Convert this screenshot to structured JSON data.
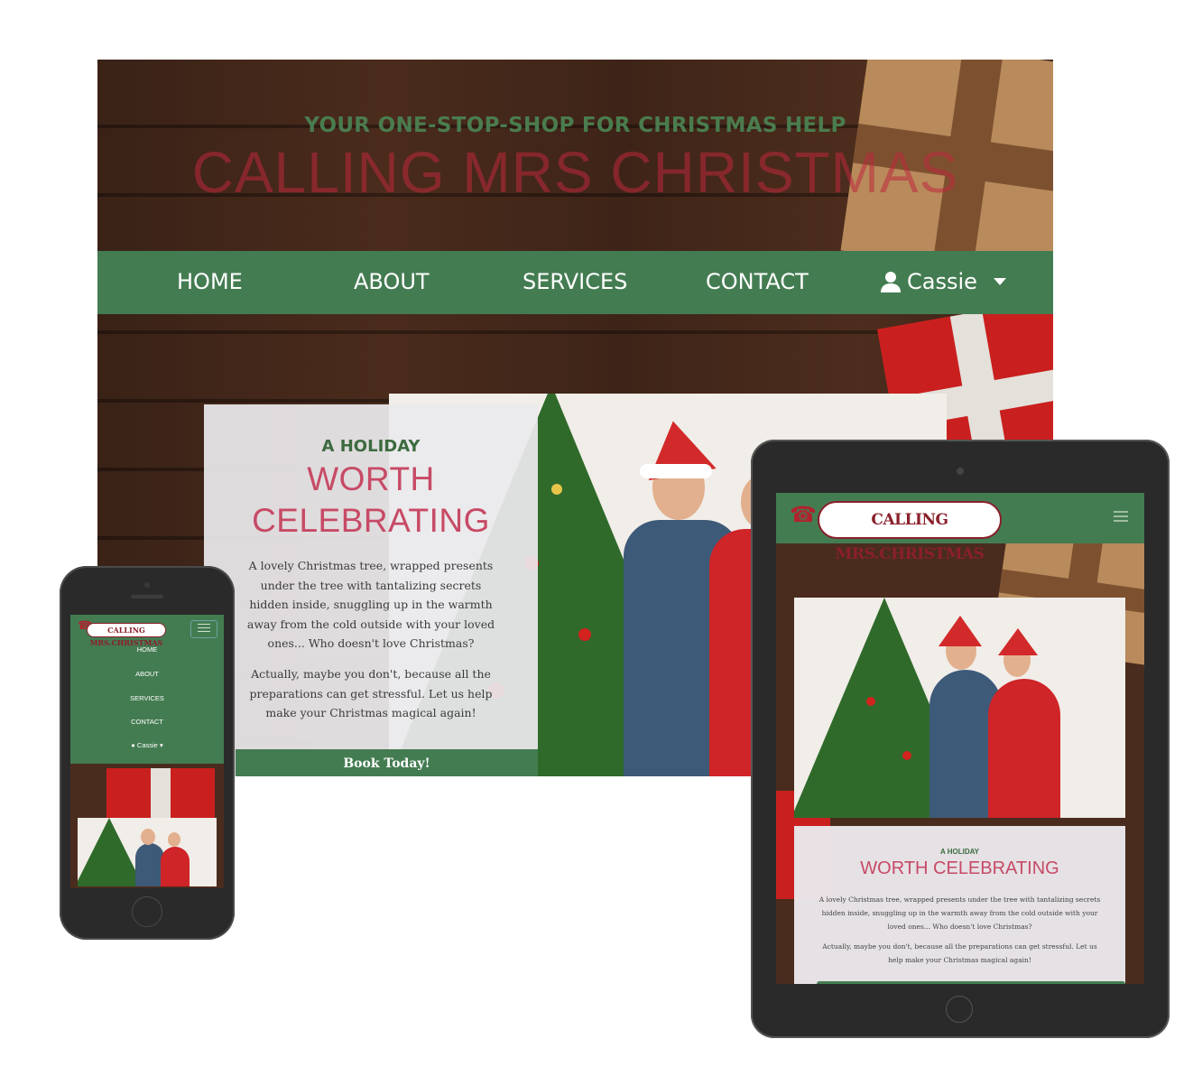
{
  "desktop": {
    "tagline": "YOUR ONE-STOP-SHOP FOR CHRISTMAS HELP",
    "site_title": "CALLING MRS CHRISTMAS",
    "nav": {
      "home": "HOME",
      "about": "ABOUT",
      "services": "SERVICES",
      "contact": "CONTACT",
      "user": "Cassie"
    },
    "card": {
      "eyebrow": "A HOLIDAY",
      "heading_line1": "WORTH",
      "heading_line2": "CELEBRATING",
      "paragraph1": "A lovely Christmas tree, wrapped presents under the tree with tantalizing secrets hidden inside, snuggling up in the warmth away from the cold outside with your loved ones... Who doesn't love Christmas?",
      "paragraph2": "Actually, maybe you don't, because all the preparations can get stressful. Let us help make your Christmas magical again!",
      "cta": "Book Today!"
    }
  },
  "tablet": {
    "logo_text": "CALLING MRS.CHRISTMAS",
    "card": {
      "eyebrow": "A HOLIDAY",
      "heading": "WORTH CELEBRATING",
      "paragraph1": "A lovely Christmas tree, wrapped presents under the tree with tantalizing secrets hidden inside, snuggling up in the warmth away from the cold outside with your loved ones... Who doesn't love Christmas?",
      "paragraph2": "Actually, maybe you don't, because all the preparations can get stressful. Let us help make your Christmas magical again!"
    }
  },
  "phone": {
    "logo_text": "CALLING MRS.CHRISTMAS",
    "menu": {
      "home": "HOME",
      "about": "ABOUT",
      "services": "SERVICES",
      "contact": "CONTACT",
      "user": "Cassie"
    }
  },
  "colors": {
    "brand_green": "#447c52",
    "tagline_green": "#4a7c4e",
    "heading_rose": "#c74a66",
    "logo_red": "#8a1f2a",
    "wood_brown": "#3e2418"
  },
  "icons": [
    "user-icon",
    "caret-down-icon",
    "hamburger-icon",
    "telephone-icon"
  ]
}
